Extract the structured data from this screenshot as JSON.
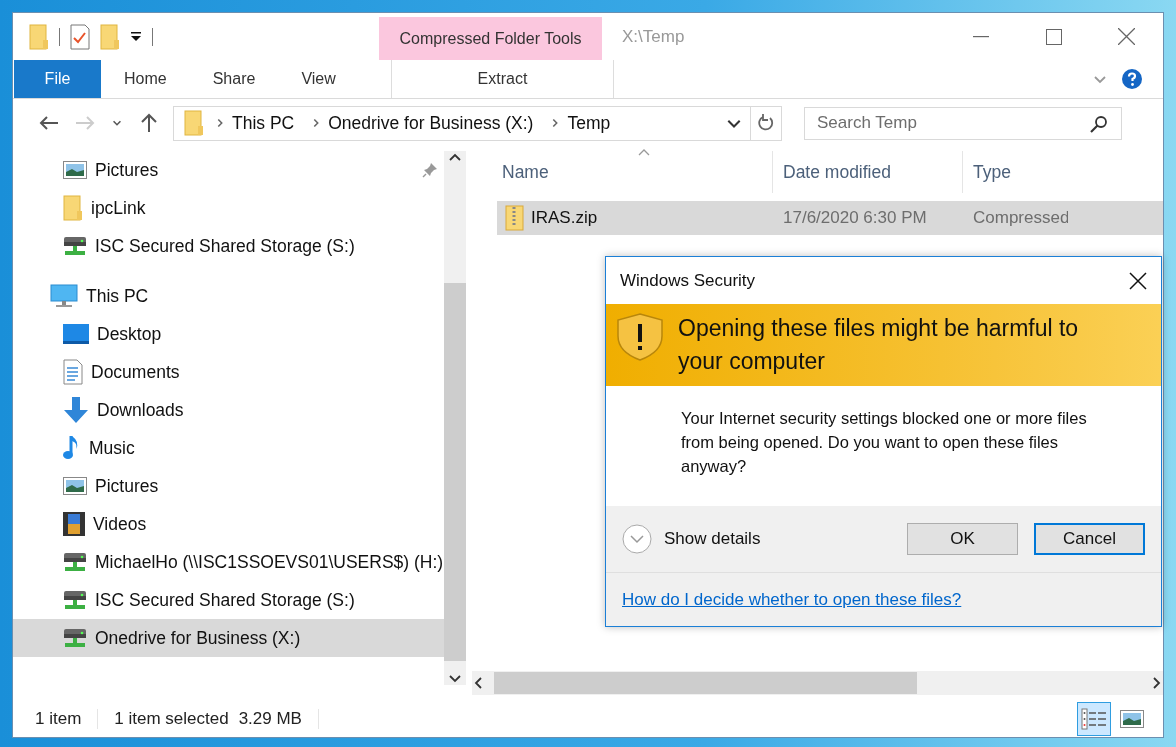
{
  "window": {
    "title": "X:\\Temp",
    "context_tab_group": "Compressed Folder Tools"
  },
  "ribbon_tabs": [
    {
      "label": "File",
      "kind": "file"
    },
    {
      "label": "Home",
      "kind": "tab"
    },
    {
      "label": "Share",
      "kind": "tab"
    },
    {
      "label": "View",
      "kind": "tab"
    },
    {
      "label": "Extract",
      "kind": "context"
    }
  ],
  "address_bar": {
    "breadcrumbs": [
      "This PC",
      "Onedrive for Business (X:)",
      "Temp"
    ]
  },
  "search": {
    "placeholder": "Search Temp"
  },
  "navigation": {
    "quick_access_items": [
      {
        "label": "Pictures",
        "kind": "pictures",
        "pinned": true,
        "selected": false
      },
      {
        "label": "ipcLink",
        "kind": "folder",
        "pinned": false,
        "selected": false
      },
      {
        "label": "ISC Secured Shared Storage (S:)",
        "kind": "drive",
        "pinned": false,
        "selected": false
      }
    ],
    "tree": [
      {
        "label": "This PC",
        "kind": "pc",
        "selected": false,
        "children": [
          {
            "label": "Desktop",
            "kind": "desktop",
            "selected": false
          },
          {
            "label": "Documents",
            "kind": "documents",
            "selected": false
          },
          {
            "label": "Downloads",
            "kind": "downloads",
            "selected": false
          },
          {
            "label": "Music",
            "kind": "music",
            "selected": false
          },
          {
            "label": "Pictures",
            "kind": "pictures",
            "selected": false
          },
          {
            "label": "Videos",
            "kind": "videos",
            "selected": false
          },
          {
            "label": "MichaelHo (\\\\ISC1SSOEVS01\\USERS$) (H:)",
            "kind": "drive",
            "selected": false
          },
          {
            "label": "ISC Secured Shared Storage (S:)",
            "kind": "drive",
            "selected": false
          },
          {
            "label": "Onedrive for Business (X:)",
            "kind": "drive",
            "selected": true
          }
        ]
      }
    ]
  },
  "file_list": {
    "columns": [
      "Name",
      "Date modified",
      "Type"
    ],
    "rows": [
      {
        "name": "IRAS.zip",
        "date_modified": "17/6/2020 6:30 PM",
        "type": "Compressed",
        "selected": true
      }
    ]
  },
  "status_bar": {
    "item_count": "1 item",
    "selection": "1 item selected",
    "size": "3.29 MB",
    "views": [
      {
        "kind": "details",
        "selected": true
      },
      {
        "kind": "large-icons",
        "selected": false
      }
    ]
  },
  "dialog": {
    "title": "Windows Security",
    "heading": "Opening these files might be harmful to your computer",
    "message": "Your Internet security settings blocked one or more files from being opened. Do you want to open these files anyway?",
    "details_toggle": "Show details",
    "buttons": [
      {
        "label": "OK",
        "focused": false
      },
      {
        "label": "Cancel",
        "focused": true
      }
    ],
    "help_link": "How do I decide whether to open these files?"
  }
}
